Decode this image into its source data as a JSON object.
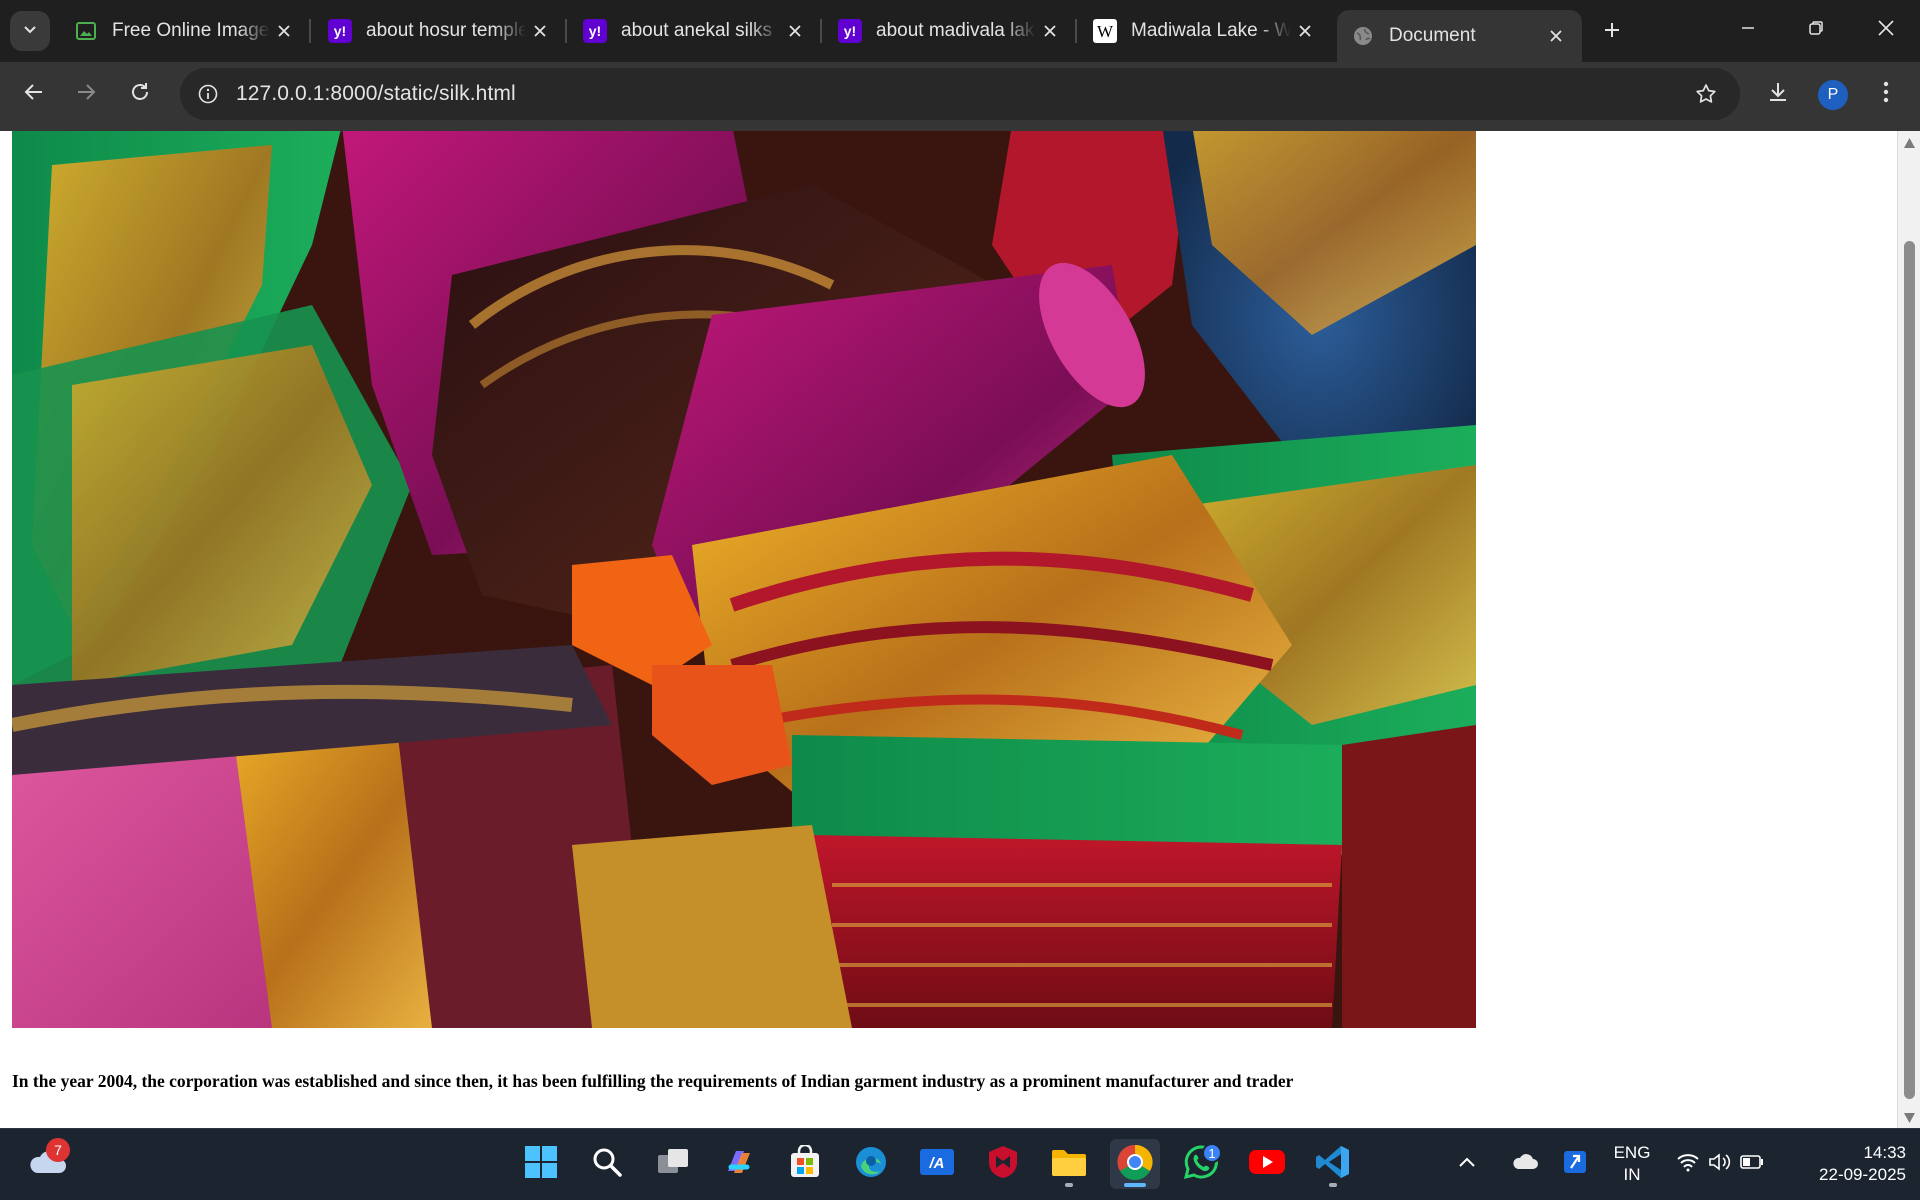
{
  "browser": {
    "tabs": [
      {
        "title": "Free Online Image",
        "favicon": "image-editor-icon",
        "active": false
      },
      {
        "title": "about hosur temple",
        "favicon": "yahoo-icon",
        "active": false
      },
      {
        "title": "about anekal silks",
        "favicon": "yahoo-icon",
        "active": false
      },
      {
        "title": "about madivala lake",
        "favicon": "yahoo-icon",
        "active": false
      },
      {
        "title": "Madiwala Lake - W",
        "favicon": "wikipedia-icon",
        "active": false
      },
      {
        "title": "Document",
        "favicon": "globe-icon",
        "active": true
      }
    ],
    "url": "127.0.0.1:8000/static/silk.html",
    "profile_initial": "P"
  },
  "page": {
    "image_alt": "Stack of colorful silk sarees",
    "caption": "In the year 2004, the corporation was established and since then, it has been fulfilling the requirements of Indian garment industry as a prominent manufacturer and trader"
  },
  "taskbar": {
    "weather_badge": "7",
    "whatsapp_badge": "1",
    "language_top": "ENG",
    "language_bottom": "IN",
    "time": "14:33",
    "date": "22-09-2025"
  },
  "colors": {
    "chrome_dark": "#1f1f1f",
    "toolbar": "#353535",
    "taskbar": "#1c2430",
    "accent_blue": "#5cb7ff"
  }
}
